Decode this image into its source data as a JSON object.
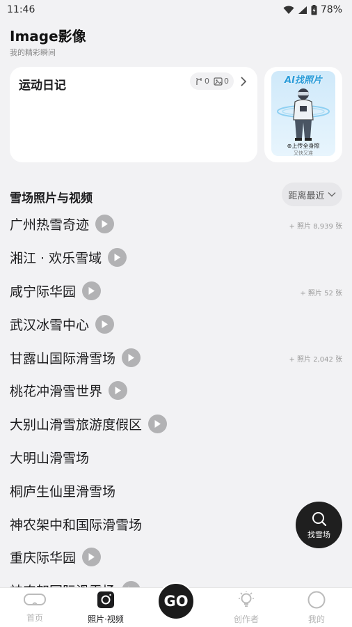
{
  "status": {
    "time": "11:46",
    "battery": "78%"
  },
  "header": {
    "title": "Image影像",
    "subtitle": "我的精彩瞬间"
  },
  "diary": {
    "title": "运动日记",
    "tracks_count": "0",
    "photos_count": "0"
  },
  "ai_card": {
    "title": "AI找照片",
    "upload_label": "⊕上传全身照",
    "note": "又快又准"
  },
  "section": {
    "title": "雪场照片与视频",
    "sort_label": "距离最近"
  },
  "resorts": [
    {
      "name": "广州热雪奇迹",
      "has_video": true,
      "photo_count": "+ 照片 8,939 张"
    },
    {
      "name": "湘江 · 欢乐雪域",
      "has_video": true,
      "photo_count": ""
    },
    {
      "name": "咸宁际华园",
      "has_video": true,
      "photo_count": "+ 照片 52 张"
    },
    {
      "name": "武汉冰雪中心",
      "has_video": true,
      "photo_count": ""
    },
    {
      "name": "甘露山国际滑雪场",
      "has_video": true,
      "photo_count": "+ 照片 2,042 张"
    },
    {
      "name": "桃花冲滑雪世界",
      "has_video": true,
      "photo_count": ""
    },
    {
      "name": "大别山滑雪旅游度假区",
      "has_video": true,
      "photo_count": ""
    },
    {
      "name": "大明山滑雪场",
      "has_video": false,
      "photo_count": ""
    },
    {
      "name": "桐庐生仙里滑雪场",
      "has_video": false,
      "photo_count": ""
    },
    {
      "name": "神农架中和国际滑雪场",
      "has_video": false,
      "photo_count": ""
    },
    {
      "name": "重庆际华园",
      "has_video": true,
      "photo_count": ""
    },
    {
      "name": "神农架国际滑雪场",
      "has_video": true,
      "photo_count": ""
    }
  ],
  "fab": {
    "label": "找雪场"
  },
  "tabs": [
    {
      "label": "首页",
      "icon": "goggles-icon",
      "active": false
    },
    {
      "label": "照片·视频",
      "icon": "camera-icon",
      "active": true
    },
    {
      "label": "创作者",
      "icon": "lightbulb-icon",
      "active": false
    },
    {
      "label": "我的",
      "icon": "profile-circle-icon",
      "active": false
    }
  ],
  "go_button": {
    "label": "GO"
  },
  "colors": {
    "background": "#f2f2f4",
    "accent": "#1b1b1b",
    "play": "#b2b2b4",
    "ai_title": "#2a9cd9"
  }
}
